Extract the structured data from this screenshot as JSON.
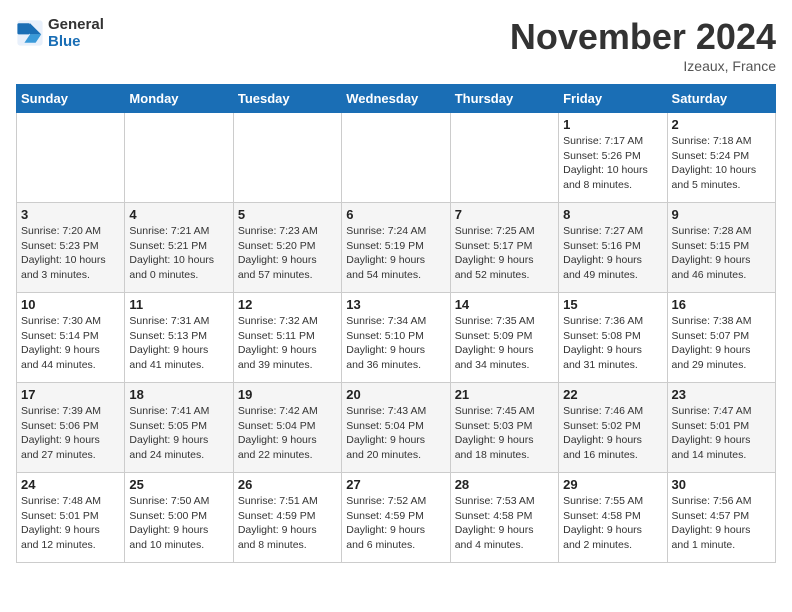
{
  "logo": {
    "text_general": "General",
    "text_blue": "Blue"
  },
  "header": {
    "month_title": "November 2024",
    "location": "Izeaux, France"
  },
  "weekdays": [
    "Sunday",
    "Monday",
    "Tuesday",
    "Wednesday",
    "Thursday",
    "Friday",
    "Saturday"
  ],
  "weeks": [
    [
      {
        "day": "",
        "info": ""
      },
      {
        "day": "",
        "info": ""
      },
      {
        "day": "",
        "info": ""
      },
      {
        "day": "",
        "info": ""
      },
      {
        "day": "",
        "info": ""
      },
      {
        "day": "1",
        "info": "Sunrise: 7:17 AM\nSunset: 5:26 PM\nDaylight: 10 hours\nand 8 minutes."
      },
      {
        "day": "2",
        "info": "Sunrise: 7:18 AM\nSunset: 5:24 PM\nDaylight: 10 hours\nand 5 minutes."
      }
    ],
    [
      {
        "day": "3",
        "info": "Sunrise: 7:20 AM\nSunset: 5:23 PM\nDaylight: 10 hours\nand 3 minutes."
      },
      {
        "day": "4",
        "info": "Sunrise: 7:21 AM\nSunset: 5:21 PM\nDaylight: 10 hours\nand 0 minutes."
      },
      {
        "day": "5",
        "info": "Sunrise: 7:23 AM\nSunset: 5:20 PM\nDaylight: 9 hours\nand 57 minutes."
      },
      {
        "day": "6",
        "info": "Sunrise: 7:24 AM\nSunset: 5:19 PM\nDaylight: 9 hours\nand 54 minutes."
      },
      {
        "day": "7",
        "info": "Sunrise: 7:25 AM\nSunset: 5:17 PM\nDaylight: 9 hours\nand 52 minutes."
      },
      {
        "day": "8",
        "info": "Sunrise: 7:27 AM\nSunset: 5:16 PM\nDaylight: 9 hours\nand 49 minutes."
      },
      {
        "day": "9",
        "info": "Sunrise: 7:28 AM\nSunset: 5:15 PM\nDaylight: 9 hours\nand 46 minutes."
      }
    ],
    [
      {
        "day": "10",
        "info": "Sunrise: 7:30 AM\nSunset: 5:14 PM\nDaylight: 9 hours\nand 44 minutes."
      },
      {
        "day": "11",
        "info": "Sunrise: 7:31 AM\nSunset: 5:13 PM\nDaylight: 9 hours\nand 41 minutes."
      },
      {
        "day": "12",
        "info": "Sunrise: 7:32 AM\nSunset: 5:11 PM\nDaylight: 9 hours\nand 39 minutes."
      },
      {
        "day": "13",
        "info": "Sunrise: 7:34 AM\nSunset: 5:10 PM\nDaylight: 9 hours\nand 36 minutes."
      },
      {
        "day": "14",
        "info": "Sunrise: 7:35 AM\nSunset: 5:09 PM\nDaylight: 9 hours\nand 34 minutes."
      },
      {
        "day": "15",
        "info": "Sunrise: 7:36 AM\nSunset: 5:08 PM\nDaylight: 9 hours\nand 31 minutes."
      },
      {
        "day": "16",
        "info": "Sunrise: 7:38 AM\nSunset: 5:07 PM\nDaylight: 9 hours\nand 29 minutes."
      }
    ],
    [
      {
        "day": "17",
        "info": "Sunrise: 7:39 AM\nSunset: 5:06 PM\nDaylight: 9 hours\nand 27 minutes."
      },
      {
        "day": "18",
        "info": "Sunrise: 7:41 AM\nSunset: 5:05 PM\nDaylight: 9 hours\nand 24 minutes."
      },
      {
        "day": "19",
        "info": "Sunrise: 7:42 AM\nSunset: 5:04 PM\nDaylight: 9 hours\nand 22 minutes."
      },
      {
        "day": "20",
        "info": "Sunrise: 7:43 AM\nSunset: 5:04 PM\nDaylight: 9 hours\nand 20 minutes."
      },
      {
        "day": "21",
        "info": "Sunrise: 7:45 AM\nSunset: 5:03 PM\nDaylight: 9 hours\nand 18 minutes."
      },
      {
        "day": "22",
        "info": "Sunrise: 7:46 AM\nSunset: 5:02 PM\nDaylight: 9 hours\nand 16 minutes."
      },
      {
        "day": "23",
        "info": "Sunrise: 7:47 AM\nSunset: 5:01 PM\nDaylight: 9 hours\nand 14 minutes."
      }
    ],
    [
      {
        "day": "24",
        "info": "Sunrise: 7:48 AM\nSunset: 5:01 PM\nDaylight: 9 hours\nand 12 minutes."
      },
      {
        "day": "25",
        "info": "Sunrise: 7:50 AM\nSunset: 5:00 PM\nDaylight: 9 hours\nand 10 minutes."
      },
      {
        "day": "26",
        "info": "Sunrise: 7:51 AM\nSunset: 4:59 PM\nDaylight: 9 hours\nand 8 minutes."
      },
      {
        "day": "27",
        "info": "Sunrise: 7:52 AM\nSunset: 4:59 PM\nDaylight: 9 hours\nand 6 minutes."
      },
      {
        "day": "28",
        "info": "Sunrise: 7:53 AM\nSunset: 4:58 PM\nDaylight: 9 hours\nand 4 minutes."
      },
      {
        "day": "29",
        "info": "Sunrise: 7:55 AM\nSunset: 4:58 PM\nDaylight: 9 hours\nand 2 minutes."
      },
      {
        "day": "30",
        "info": "Sunrise: 7:56 AM\nSunset: 4:57 PM\nDaylight: 9 hours\nand 1 minute."
      }
    ]
  ]
}
